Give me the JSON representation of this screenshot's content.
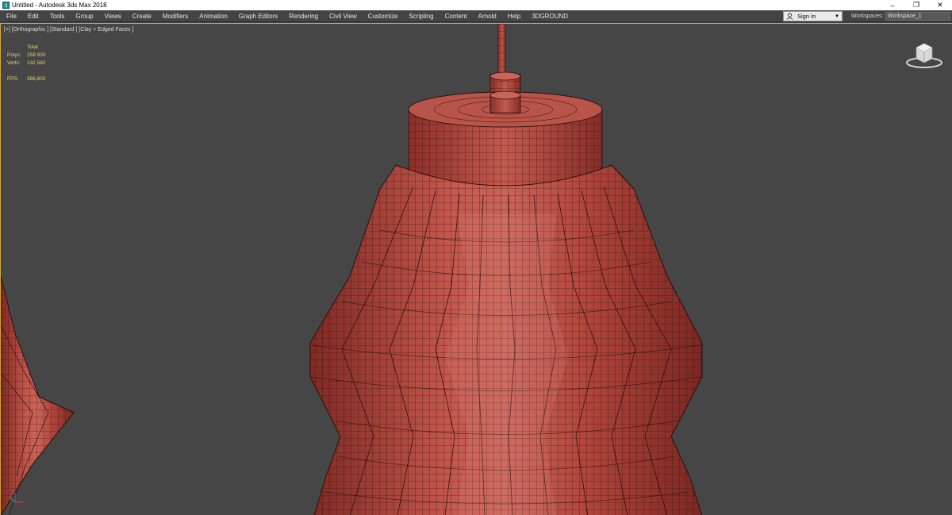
{
  "window": {
    "title": "Untitled - Autodesk 3ds Max 2018",
    "icons": {
      "app": "3ds-max-logo-icon",
      "minimize": "minimize-icon",
      "maximize": "restore-icon",
      "close": "close-icon"
    },
    "controls": {
      "minimize": "–",
      "maximize": "❐",
      "close": "✕"
    }
  },
  "menu": {
    "items": [
      "File",
      "Edit",
      "Tools",
      "Group",
      "Views",
      "Create",
      "Modifiers",
      "Animation",
      "Graph Editors",
      "Rendering",
      "Civil View",
      "Customize",
      "Scripting",
      "Content",
      "Arnold",
      "Help",
      "3DGROUND"
    ],
    "signin_label": "Sign In",
    "workspaces_label": "Workspaces:",
    "workspace_value": "Workspace_1"
  },
  "viewport": {
    "label": "[+] [Orthographic ] [Standard ] [Clay + Edged Faces ]",
    "stats": {
      "header": "Total",
      "polys_label": "Polys:",
      "polys_value": "258 930",
      "verts_label": "Verts:",
      "verts_value": "132 582",
      "fps_label": "FPS:",
      "fps_value": "386,802"
    },
    "colors": {
      "background": "#464646",
      "active_border": "#d7a83a",
      "clay": "#b4463c",
      "wire": "#2a0e0c",
      "stats_text": "#e6d46a"
    }
  }
}
